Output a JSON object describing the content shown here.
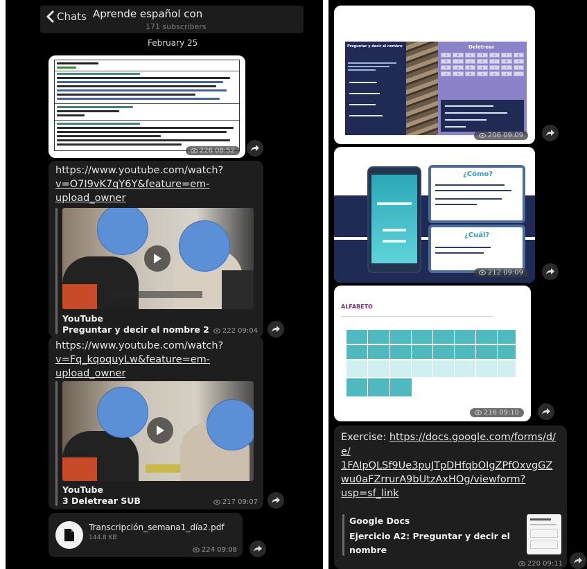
{
  "header": {
    "back_label": "Chats",
    "channel_title": "Aprende español con",
    "subscribers": "171 subscribers"
  },
  "date_label": "February 25",
  "messages_left": [
    {
      "type": "document_image",
      "meta": "226 08:52"
    },
    {
      "type": "youtube_link",
      "url_lines": [
        "https://www.youtube.com/watch?",
        "v=O7I9vK7qY6Y&feature=em-",
        "upload_owner"
      ],
      "source": "YouTube",
      "title": "Preguntar y decir el nombre 2",
      "meta": "222 09:04"
    },
    {
      "type": "youtube_link",
      "url_lines": [
        "https://www.youtube.com/watch?",
        "v=Fq_kqoquyLw&feature=em-",
        "upload_owner"
      ],
      "source": "YouTube",
      "title": "3 Deletrear SUB",
      "meta": "217 09:07"
    },
    {
      "type": "file",
      "filename": "Transcripción_semana1_día2.pdf",
      "size": "144.8 KB",
      "meta": "224 09:08"
    }
  ],
  "messages_right": [
    {
      "type": "slide",
      "meta": "206 09:09",
      "left_title": "Preguntar y decir el nombre",
      "right_title": "Deletrear"
    },
    {
      "type": "slide",
      "meta": "212 09:09",
      "card1_title": "¿Cómo?",
      "card2_title": "¿Cuál?"
    },
    {
      "type": "slide",
      "meta": "216 09:10",
      "title": "ALFABETO"
    },
    {
      "type": "exercise_link",
      "prefix": "Exercise: ",
      "url_lines": [
        "https://docs.google.com/forms/d/",
        "e/",
        "1FAIpQLSf9Ue3puJTpDHfqbOIgZPfOxvgGZ",
        "wu0aFZrrurA9bUtzAxHOg/viewform?",
        "usp=sf_link"
      ],
      "source": "Google Docs",
      "title_lines": [
        "Ejercicio A2: Preguntar y decir el",
        "nombre"
      ],
      "meta": "220 09:11"
    }
  ],
  "colors": {
    "background": "#000000",
    "bubble": "#1e1e1e",
    "slide_purple": "#8a83c9",
    "slide_navy": "#1f2b55",
    "slide_teal": "#4fb9c0"
  },
  "icons": [
    "back-chevron-icon",
    "play-icon",
    "share-arrow-icon",
    "file-icon",
    "eye-icon"
  ]
}
